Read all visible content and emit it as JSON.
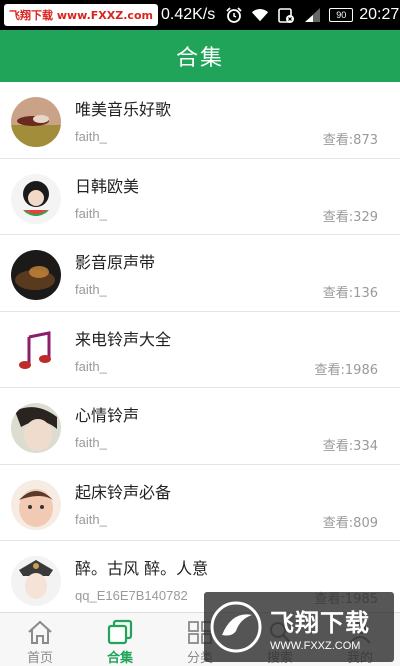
{
  "status_bar": {
    "brand": "飞翔下载 www.FXXZ.com",
    "net_speed": "0.42K/s",
    "battery": "90",
    "time": "20:27",
    "icons": [
      "alarm-icon",
      "wifi-icon",
      "sim-icon",
      "signal-icon"
    ]
  },
  "header": {
    "title": "合集"
  },
  "list": [
    {
      "title": "唯美音乐好歌",
      "author": "faith_",
      "views": "查看:873"
    },
    {
      "title": "日韩欧美",
      "author": "faith_",
      "views": "查看:329"
    },
    {
      "title": "影音原声带",
      "author": "faith_",
      "views": "查看:136"
    },
    {
      "title": "来电铃声大全",
      "author": "faith_",
      "views": "查看:1986"
    },
    {
      "title": "心情铃声",
      "author": "faith_",
      "views": "查看:334"
    },
    {
      "title": "起床铃声必备",
      "author": "faith_",
      "views": "查看:809"
    },
    {
      "title": "醉。古风 醉。人意",
      "author": "qq_E16E7B140782",
      "views": "查看:1985"
    }
  ],
  "bottom_nav": [
    {
      "label": "首页",
      "icon": "home-icon",
      "active": false
    },
    {
      "label": "合集",
      "icon": "collection-icon",
      "active": true
    },
    {
      "label": "分类",
      "icon": "category-icon",
      "active": false
    },
    {
      "label": "搜索",
      "icon": "search-icon",
      "active": false
    },
    {
      "label": "我的",
      "icon": "profile-icon",
      "active": false
    }
  ],
  "watermark": {
    "text": "飞翔下载",
    "url": "WWW.FXXZ.COM"
  },
  "colors": {
    "accent": "#1fa45a",
    "status_bar": "#000000",
    "muted_text": "#9a9a9a"
  }
}
